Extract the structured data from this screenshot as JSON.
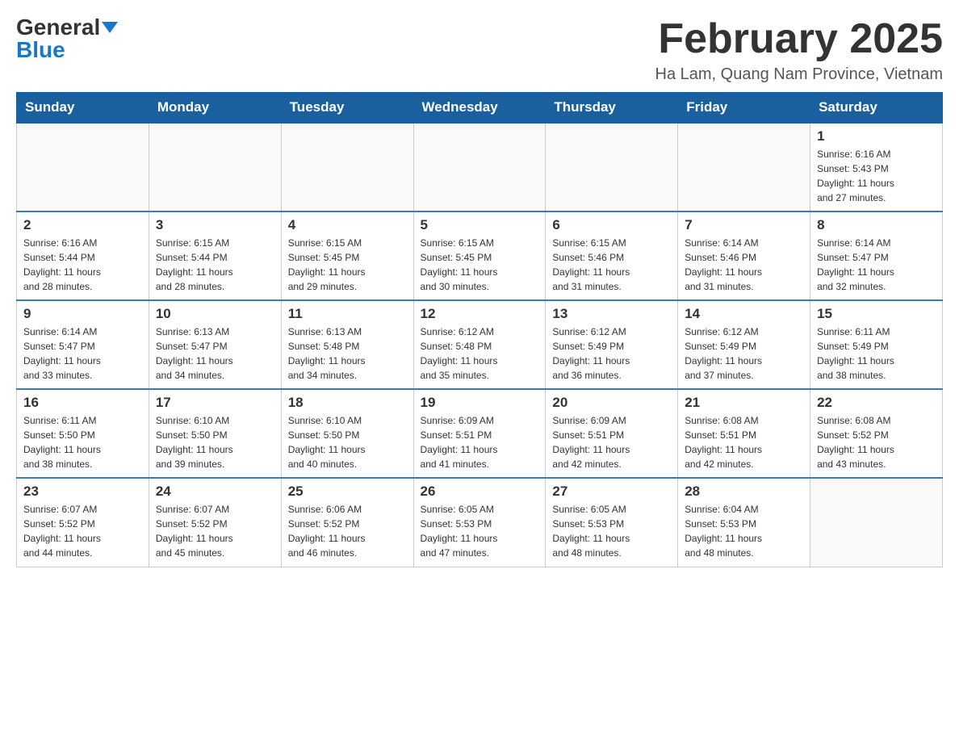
{
  "header": {
    "logo_general": "General",
    "logo_blue": "Blue",
    "month_title": "February 2025",
    "location": "Ha Lam, Quang Nam Province, Vietnam"
  },
  "days_of_week": [
    "Sunday",
    "Monday",
    "Tuesday",
    "Wednesday",
    "Thursday",
    "Friday",
    "Saturday"
  ],
  "weeks": [
    [
      {
        "day": "",
        "info": ""
      },
      {
        "day": "",
        "info": ""
      },
      {
        "day": "",
        "info": ""
      },
      {
        "day": "",
        "info": ""
      },
      {
        "day": "",
        "info": ""
      },
      {
        "day": "",
        "info": ""
      },
      {
        "day": "1",
        "info": "Sunrise: 6:16 AM\nSunset: 5:43 PM\nDaylight: 11 hours\nand 27 minutes."
      }
    ],
    [
      {
        "day": "2",
        "info": "Sunrise: 6:16 AM\nSunset: 5:44 PM\nDaylight: 11 hours\nand 28 minutes."
      },
      {
        "day": "3",
        "info": "Sunrise: 6:15 AM\nSunset: 5:44 PM\nDaylight: 11 hours\nand 28 minutes."
      },
      {
        "day": "4",
        "info": "Sunrise: 6:15 AM\nSunset: 5:45 PM\nDaylight: 11 hours\nand 29 minutes."
      },
      {
        "day": "5",
        "info": "Sunrise: 6:15 AM\nSunset: 5:45 PM\nDaylight: 11 hours\nand 30 minutes."
      },
      {
        "day": "6",
        "info": "Sunrise: 6:15 AM\nSunset: 5:46 PM\nDaylight: 11 hours\nand 31 minutes."
      },
      {
        "day": "7",
        "info": "Sunrise: 6:14 AM\nSunset: 5:46 PM\nDaylight: 11 hours\nand 31 minutes."
      },
      {
        "day": "8",
        "info": "Sunrise: 6:14 AM\nSunset: 5:47 PM\nDaylight: 11 hours\nand 32 minutes."
      }
    ],
    [
      {
        "day": "9",
        "info": "Sunrise: 6:14 AM\nSunset: 5:47 PM\nDaylight: 11 hours\nand 33 minutes."
      },
      {
        "day": "10",
        "info": "Sunrise: 6:13 AM\nSunset: 5:47 PM\nDaylight: 11 hours\nand 34 minutes."
      },
      {
        "day": "11",
        "info": "Sunrise: 6:13 AM\nSunset: 5:48 PM\nDaylight: 11 hours\nand 34 minutes."
      },
      {
        "day": "12",
        "info": "Sunrise: 6:12 AM\nSunset: 5:48 PM\nDaylight: 11 hours\nand 35 minutes."
      },
      {
        "day": "13",
        "info": "Sunrise: 6:12 AM\nSunset: 5:49 PM\nDaylight: 11 hours\nand 36 minutes."
      },
      {
        "day": "14",
        "info": "Sunrise: 6:12 AM\nSunset: 5:49 PM\nDaylight: 11 hours\nand 37 minutes."
      },
      {
        "day": "15",
        "info": "Sunrise: 6:11 AM\nSunset: 5:49 PM\nDaylight: 11 hours\nand 38 minutes."
      }
    ],
    [
      {
        "day": "16",
        "info": "Sunrise: 6:11 AM\nSunset: 5:50 PM\nDaylight: 11 hours\nand 38 minutes."
      },
      {
        "day": "17",
        "info": "Sunrise: 6:10 AM\nSunset: 5:50 PM\nDaylight: 11 hours\nand 39 minutes."
      },
      {
        "day": "18",
        "info": "Sunrise: 6:10 AM\nSunset: 5:50 PM\nDaylight: 11 hours\nand 40 minutes."
      },
      {
        "day": "19",
        "info": "Sunrise: 6:09 AM\nSunset: 5:51 PM\nDaylight: 11 hours\nand 41 minutes."
      },
      {
        "day": "20",
        "info": "Sunrise: 6:09 AM\nSunset: 5:51 PM\nDaylight: 11 hours\nand 42 minutes."
      },
      {
        "day": "21",
        "info": "Sunrise: 6:08 AM\nSunset: 5:51 PM\nDaylight: 11 hours\nand 42 minutes."
      },
      {
        "day": "22",
        "info": "Sunrise: 6:08 AM\nSunset: 5:52 PM\nDaylight: 11 hours\nand 43 minutes."
      }
    ],
    [
      {
        "day": "23",
        "info": "Sunrise: 6:07 AM\nSunset: 5:52 PM\nDaylight: 11 hours\nand 44 minutes."
      },
      {
        "day": "24",
        "info": "Sunrise: 6:07 AM\nSunset: 5:52 PM\nDaylight: 11 hours\nand 45 minutes."
      },
      {
        "day": "25",
        "info": "Sunrise: 6:06 AM\nSunset: 5:52 PM\nDaylight: 11 hours\nand 46 minutes."
      },
      {
        "day": "26",
        "info": "Sunrise: 6:05 AM\nSunset: 5:53 PM\nDaylight: 11 hours\nand 47 minutes."
      },
      {
        "day": "27",
        "info": "Sunrise: 6:05 AM\nSunset: 5:53 PM\nDaylight: 11 hours\nand 48 minutes."
      },
      {
        "day": "28",
        "info": "Sunrise: 6:04 AM\nSunset: 5:53 PM\nDaylight: 11 hours\nand 48 minutes."
      },
      {
        "day": "",
        "info": ""
      }
    ]
  ]
}
